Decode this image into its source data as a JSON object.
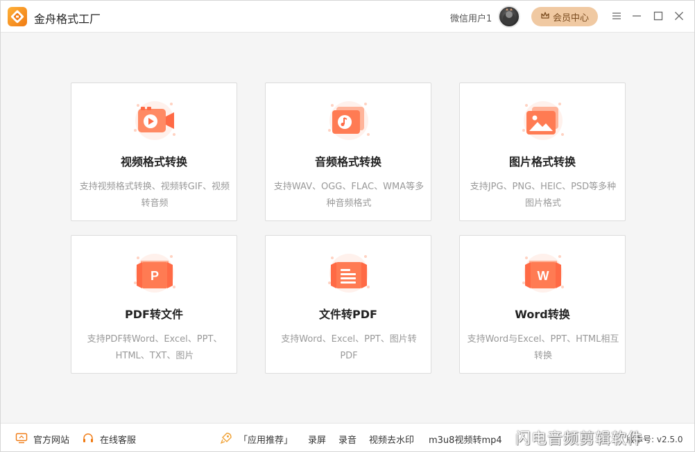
{
  "app": {
    "title": "金舟格式工厂",
    "logo_icon": "app-logo-icon",
    "accent": "#f07a12"
  },
  "header": {
    "username": "微信用户1",
    "vip_label": "会员中心",
    "vip_color": "#f0c9a2",
    "controls": [
      "menu-icon",
      "minimize-icon",
      "maximize-icon",
      "close-icon"
    ]
  },
  "cards": [
    {
      "title": "视频格式转换",
      "desc": "支持视频格式转换、视频转GIF、视频转音频",
      "icon": "video-convert-icon"
    },
    {
      "title": "音频格式转换",
      "desc": "支持WAV、OGG、FLAC、WMA等多种音频格式",
      "icon": "audio-convert-icon"
    },
    {
      "title": "图片格式转换",
      "desc": "支持JPG、PNG、HEIC、PSD等多种图片格式",
      "icon": "image-convert-icon"
    },
    {
      "title": "PDF转文件",
      "desc": "支持PDF转Word、Excel、PPT、HTML、TXT、图片",
      "icon": "pdf-to-file-icon",
      "glyph": "P"
    },
    {
      "title": "文件转PDF",
      "desc": "支持Word、Excel、PPT、图片转PDF",
      "icon": "file-to-pdf-icon"
    },
    {
      "title": "Word转换",
      "desc": "支持Word与Excel、PPT、HTML相互转换",
      "icon": "word-convert-icon",
      "glyph": "W"
    }
  ],
  "footer": {
    "official_site": "官方网站",
    "online_service": "在线客服",
    "recommend": "「应用推荐」",
    "links": [
      "录屏",
      "录音",
      "视频去水印",
      "m3u8视频转mp4"
    ],
    "watermark": "闪电音频剪辑软件",
    "version": "版本号: v2.5.0"
  }
}
